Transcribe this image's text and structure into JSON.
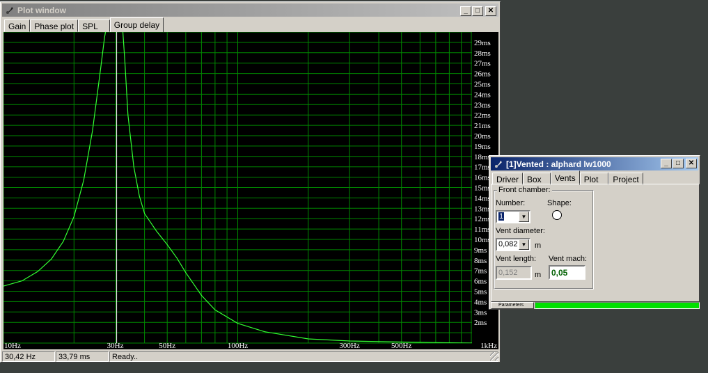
{
  "plot_window": {
    "title": "Plot window",
    "tabs": [
      {
        "label": "Gain",
        "selected": false
      },
      {
        "label": "Phase plot",
        "selected": false
      },
      {
        "label": "SPL",
        "selected": false
      },
      {
        "label": "Group delay",
        "selected": true
      }
    ],
    "status": {
      "freq": "30,42 Hz",
      "delay": "33,79 ms",
      "message": "Ready.."
    },
    "colors": {
      "grid": "#008800",
      "curve": "#33ff33",
      "cursor": "#ffffff",
      "background": "#000000"
    }
  },
  "chart_data": {
    "type": "line",
    "xscale": "log",
    "xlim": [
      10,
      1000
    ],
    "ylim": [
      0,
      30
    ],
    "y_unit": "ms",
    "x_tick_labels": [
      {
        "value": 10,
        "label": "10Hz"
      },
      {
        "value": 30,
        "label": "30Hz"
      },
      {
        "value": 50,
        "label": "50Hz"
      },
      {
        "value": 100,
        "label": "100Hz"
      },
      {
        "value": 300,
        "label": "300Hz"
      },
      {
        "value": 500,
        "label": "500Hz"
      },
      {
        "value": 1000,
        "label": "1kHz"
      }
    ],
    "y_tick_labels": [
      "2ms",
      "3ms",
      "4ms",
      "5ms",
      "6ms",
      "7ms",
      "8ms",
      "9ms",
      "10ms",
      "11ms",
      "12ms",
      "13ms",
      "14ms",
      "15ms",
      "16ms",
      "17ms",
      "18ms",
      "19ms",
      "20ms",
      "21ms",
      "22ms",
      "23ms",
      "24ms",
      "25ms",
      "26ms",
      "27ms",
      "28ms",
      "29ms"
    ],
    "cursor_x": 30.42,
    "series": [
      {
        "x": [
          10,
          12,
          14,
          16,
          18,
          20,
          22,
          24,
          26,
          27,
          28,
          29,
          30.42,
          31.5,
          32,
          33,
          34,
          36,
          38,
          40,
          45,
          50,
          55,
          60,
          70,
          80,
          100,
          130,
          200,
          300,
          500,
          700,
          1000
        ],
        "y": [
          5.5,
          6.0,
          6.9,
          8.1,
          9.8,
          12.2,
          15.7,
          20.5,
          26.5,
          29.5,
          31.5,
          33.0,
          33.79,
          33.0,
          31.5,
          27.0,
          22.0,
          17.0,
          14.2,
          12.5,
          10.8,
          9.5,
          8.2,
          6.8,
          4.6,
          3.2,
          1.9,
          1.1,
          0.4,
          0.2,
          0.1,
          0.05,
          0.0
        ]
      }
    ]
  },
  "vented_window": {
    "title": "[1]Vented : alphard lw1000",
    "tabs": [
      {
        "label": "Driver",
        "selected": false
      },
      {
        "label": "Box",
        "selected": false
      },
      {
        "label": "Vents",
        "selected": true
      },
      {
        "label": "Plot",
        "selected": false
      },
      {
        "label": "Project",
        "selected": false
      }
    ],
    "group_label": "Front chamber:",
    "number_label": "Number:",
    "number_value": "1",
    "shape_label": "Shape:",
    "vent_diameter_label": "Vent diameter:",
    "vent_diameter_value": "0,082",
    "diameter_unit": "m",
    "vent_length_label": "Vent length:",
    "vent_length_value": "0,152",
    "length_unit": "m",
    "vent_mach_label": "Vent mach:",
    "vent_mach_value": "0,05",
    "parameters_label": "Parameters",
    "progress": 1.0,
    "progress_color": "#00e000"
  }
}
